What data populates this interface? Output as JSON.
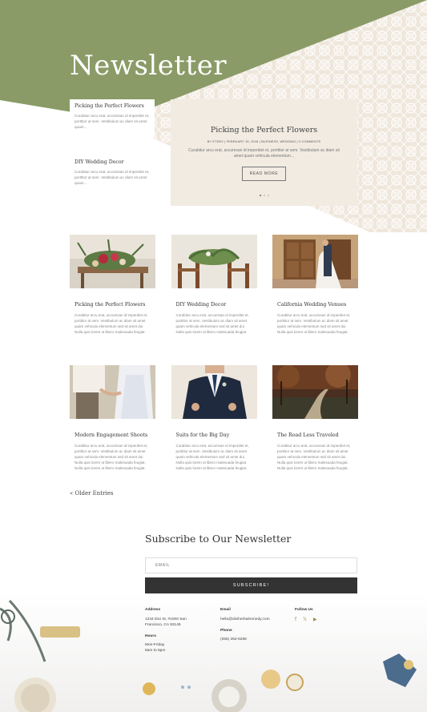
{
  "hero": {
    "title": "Newsletter",
    "accent": "#8a9b67",
    "side_posts": [
      {
        "title": "Picking the Perfect Flowers",
        "excerpt": "Curabitur arcu erat, accumsan id imperdiet et, porttitor at sem. Vestibulum ac diam sit amet quam..."
      },
      {
        "title": "DIY Wedding Decor",
        "excerpt": "Curabitur arcu erat, accumsan id imperdiet et, porttitor at sem. Vestibulum ac diam sit amet quam..."
      }
    ],
    "feature": {
      "title": "Picking the Perfect Flowers",
      "meta": "BY ETDEV | FEBRUARY 15, 2018 | BUSINESS, WEDDING | 0 COMMENTS",
      "excerpt": "Curabitur arcu erat, accumsan id imperdiet et, porttitor at sem. Vestibulum ac diam sit amet quam vehicula elementum...",
      "button": "READ MORE"
    }
  },
  "posts": [
    {
      "title": "Picking the Perfect Flowers",
      "excerpt": "Curabitur arcu erat, accumsan id imperdiet et, porttitor at sem. Vestibulum ac diam sit amet quam vehicula elementum sed sit amet dui. Nulla quis lorem ut libero malesuada feugiat."
    },
    {
      "title": "DIY Wedding Decor",
      "excerpt": "Curabitur arcu erat, accumsan id imperdiet et, porttitor at sem. Vestibulum ac diam sit amet quam vehicula elementum sed sit amet dui. Nulla quis lorem ut libero malesuada feugiat."
    },
    {
      "title": "California Wedding Venues",
      "excerpt": "Curabitur arcu erat, accumsan id imperdiet et, porttitor at sem. Vestibulum ac diam sit amet quam vehicula elementum sed sit amet dui. Nulla quis lorem ut libero malesuada feugiat."
    },
    {
      "title": "Modern Engagement Shoots",
      "excerpt": "Curabitur arcu erat, accumsan id imperdiet et, porttitor at sem. Vestibulum ac diam sit amet quam vehicula elementum sed sit amet dui. Nulla quis lorem ut libero malesuada feugiat. Nulla quis lorem ut libero malesuada feugiat."
    },
    {
      "title": "Suits for the Big Day",
      "excerpt": "Curabitur arcu erat, accumsan id imperdiet et, porttitor at sem. Vestibulum ac diam sit amet quam vehicula elementum sed sit amet dui. Nulla quis lorem ut libero malesuada feugiat. Nulla quis lorem ut libero malesuada feugiat."
    },
    {
      "title": "The Road Less Traveled",
      "excerpt": "Curabitur arcu erat, accumsan id imperdiet et, porttitor at sem. Vestibulum ac diam sit amet quam vehicula elementum sed sit amet dui. Nulla quis lorem ut libero malesuada feugiat. Nulla quis lorem ut libero malesuada feugiat."
    }
  ],
  "older_entries": "« Older Entries",
  "subscribe": {
    "title": "Subscribe to Our Newsletter",
    "email_placeholder": "EMAIL",
    "button": "SUBSCRIBE!"
  },
  "footer": {
    "address_heading": "Address",
    "address_line1": "1234 Divi St. #1000 San",
    "address_line2": "Francisco, CA 93145",
    "hours_heading": "Hours",
    "hours_line1": "Mon-Friday",
    "hours_line2": "8am to 5pm",
    "email_heading": "Email",
    "email_value": "hello@diviherbalremedy.com",
    "phone_heading": "Phone",
    "phone_value": "(255) 352-6258",
    "follow_heading": "Follow Us",
    "social_icons": [
      "facebook-icon",
      "twitter-icon",
      "youtube-icon"
    ]
  }
}
